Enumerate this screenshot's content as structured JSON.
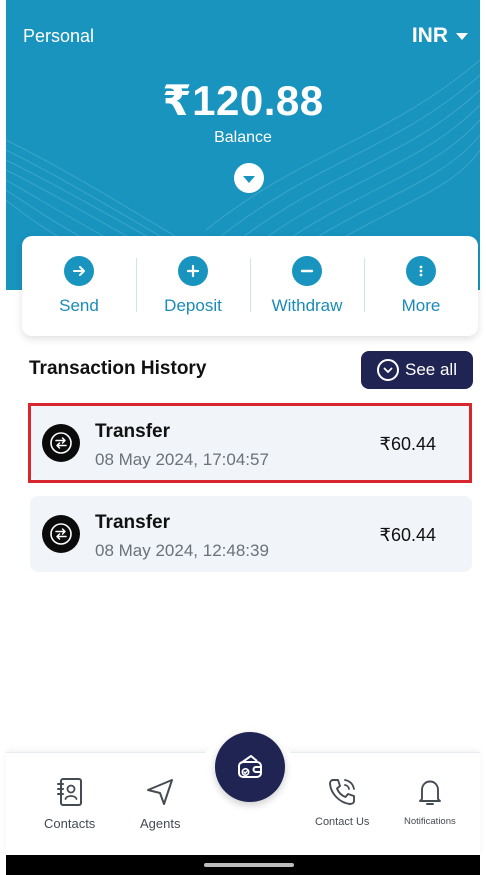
{
  "header": {
    "account_label": "Personal",
    "currency": "INR",
    "balance": "₹120.88",
    "balance_label": "Balance",
    "bg_color": "#1894bf"
  },
  "actions": [
    {
      "label": "Send",
      "icon": "arrow-right-icon"
    },
    {
      "label": "Deposit",
      "icon": "plus-icon"
    },
    {
      "label": "Withdraw",
      "icon": "minus-icon"
    },
    {
      "label": "More",
      "icon": "more-vertical-icon"
    }
  ],
  "history": {
    "title": "Transaction History",
    "see_all_label": "See all",
    "transactions": [
      {
        "title": "Transfer",
        "date": "08 May 2024, 17:04:57",
        "amount": "₹60.44",
        "icon": "transfer-icon",
        "highlighted": true
      },
      {
        "title": "Transfer",
        "date": "08 May 2024, 12:48:39",
        "amount": "₹60.44",
        "icon": "transfer-icon",
        "highlighted": false
      }
    ]
  },
  "bottom_nav": {
    "items": [
      {
        "label": "Contacts",
        "icon": "contacts-book-icon"
      },
      {
        "label": "Agents",
        "icon": "navigation-arrow-icon"
      },
      {
        "label": "Contact Us",
        "icon": "phone-call-icon"
      },
      {
        "label": "Notifications",
        "icon": "bell-icon"
      }
    ],
    "center_icon": "wallet-icon"
  },
  "colors": {
    "accent": "#1894bf",
    "navy": "#1f2453",
    "highlight": "#d8262e"
  }
}
